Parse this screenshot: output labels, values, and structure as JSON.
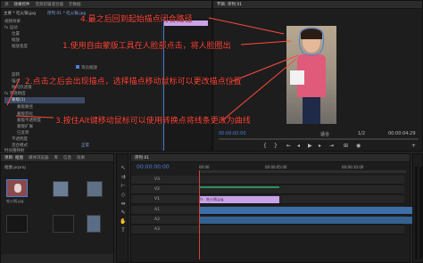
{
  "top_tabs": [
    "源",
    "效果控件",
    "音频剪辑混合器",
    "元数据"
  ],
  "effect_controls": {
    "source_label": "主要 * 吃火锅.jpg",
    "seq_label": "序列 01 * 吃火锅.jpg",
    "rows": [
      "视频效果",
      "fx 运动",
      "位置",
      "缩放",
      "缩放宽度",
      "等比缩放",
      "旋转",
      "锚点",
      "防闪烁滤镜",
      "fx 不透明度",
      "蒙版(1)",
      "蒙版路径",
      "蒙版羽化",
      "蒙版不透明度",
      "蒙版扩展",
      "已反转",
      "不透明度",
      "混合模式",
      "时间重映射"
    ],
    "values": {
      "blend": "正常",
      "opacity": "100.0 %"
    },
    "timecode": "00:00:00:00"
  },
  "program_monitor": {
    "title": "节目: 序列 01",
    "timecode_left": "00:00:00:00",
    "fit": "适合",
    "ratio": "1/2",
    "timecode_right": "00:00:04:29"
  },
  "project_panel": {
    "tabs": [
      "项目: 抠图",
      "媒体浏览器",
      "库",
      "信息",
      "效果"
    ],
    "name": "抠图.prproj",
    "thumbs": [
      "吃火锅.jpg",
      "",
      "",
      "",
      ""
    ]
  },
  "timeline": {
    "tab": "序列 01",
    "timecode": "00:00:00:00",
    "ruler": [
      "00:00",
      "00:00:05:00",
      "00:00:10:00"
    ],
    "tracks": [
      "V3",
      "V2",
      "V1",
      "A1",
      "A2",
      "A3"
    ],
    "clip_v1": "吃火锅.jpg",
    "clip_v1_fx": "fx"
  },
  "annotations": {
    "a0": "4.最之后回到起始描点闭合路径",
    "a1": "1.使用自由蒙版工具在人脸部点击，将人脸圈出",
    "a2": "2.点击之后会出现描点，选择描点移动鼠标可以更改描点位置",
    "a3": "3.按住Alt键移动鼠标可以使用转换点将线条更改为曲线"
  },
  "colors": {
    "annotation": "#ff4a3d",
    "accent_blue": "#4a7fd6",
    "clip_purple": "#c9a3e8",
    "clip_green": "#2f8f5a",
    "clip_audio": "#3c6fa8",
    "playhead": "#d24040"
  }
}
